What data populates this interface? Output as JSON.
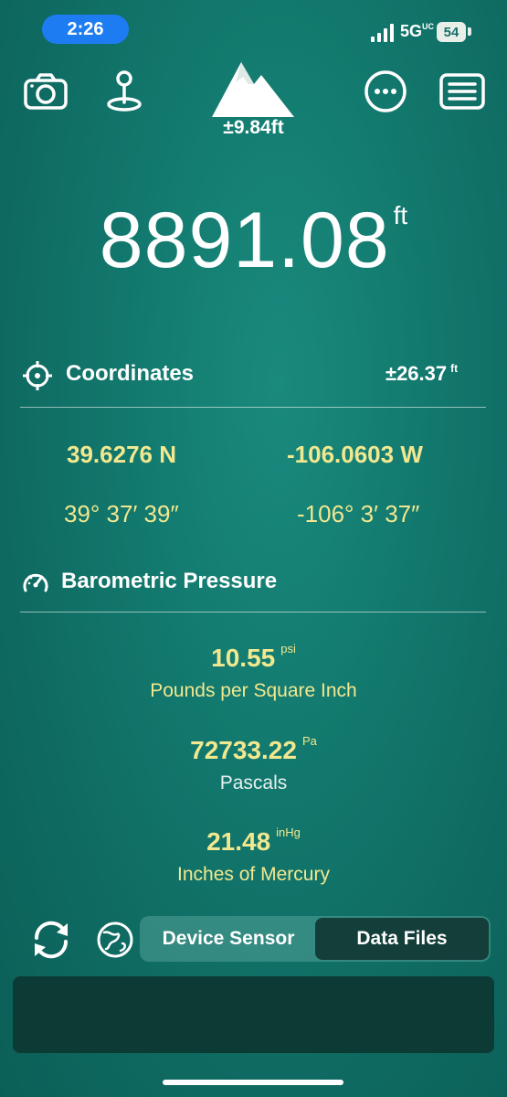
{
  "status_bar": {
    "time": "2:26",
    "network": "5G",
    "network_suffix": "UC",
    "battery": "54",
    "time_pill_color": "#1e7cf2"
  },
  "toolbar": {
    "icons": [
      "camera-icon",
      "location-pin-icon",
      "mountain-icon",
      "more-icon",
      "list-icon"
    ],
    "precision": "±9.84ft"
  },
  "elevation": {
    "value": "8891.08",
    "unit": "ft"
  },
  "coordinates": {
    "title": "Coordinates",
    "accuracy": "±26.37",
    "accuracy_unit": "ft",
    "latitude_decimal": "39.6276 N",
    "longitude_decimal": "-106.0603 W",
    "latitude_dms": "39° 37′ 39″",
    "longitude_dms": "-106° 3′ 37″"
  },
  "pressure": {
    "title": "Barometric Pressure",
    "readings": [
      {
        "value": "10.55",
        "unit": "psi",
        "label": "Pounds per Square Inch"
      },
      {
        "value": "72733.22",
        "unit": "Pa",
        "label": "Pascals"
      },
      {
        "value": "21.48",
        "unit": "inHg",
        "label": "Inches of Mercury"
      }
    ]
  },
  "source": {
    "options": [
      "Device Sensor",
      "Data Files"
    ],
    "selected": "Data Files"
  },
  "colors": {
    "accent_yellow": "#f2e88f",
    "background": "#137a6f"
  }
}
